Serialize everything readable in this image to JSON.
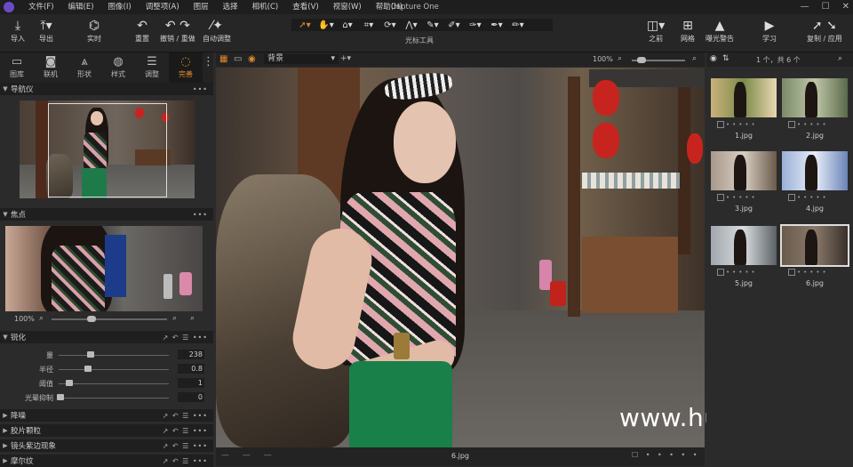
{
  "menubar": {
    "items": [
      "文件(F)",
      "编辑(E)",
      "图像(I)",
      "调整项(A)",
      "图层",
      "选择",
      "相机(C)",
      "查看(V)",
      "视窗(W)",
      "帮助(H)"
    ],
    "title": "Capture One",
    "controls": [
      "—",
      "☐",
      "✕"
    ]
  },
  "toolbar": {
    "import": "导入",
    "export": "导出",
    "live": "实时",
    "reset": "重置",
    "undo_redo": "撤销 / 重做",
    "auto_adjust": "自动调整",
    "cursor_tools": "光标工具",
    "before": "之前",
    "grid": "网格",
    "exposure_warning": "曝光警告",
    "learn": "学习",
    "copy_apply": "复制 / 应用"
  },
  "left_tabs": [
    "图库",
    "联机",
    "形状",
    "样式",
    "调整",
    "完善"
  ],
  "left_tab_active": 5,
  "navigator": {
    "title": "导航仪"
  },
  "focus": {
    "title": "焦点",
    "zoom": "100%"
  },
  "sharpening": {
    "title": "锐化",
    "sliders": [
      {
        "label": "量",
        "value": "238",
        "pos": 0.29
      },
      {
        "label": "半径",
        "value": "0.8",
        "pos": 0.27
      },
      {
        "label": "阈值",
        "value": "1",
        "pos": 0.1
      },
      {
        "label": "光晕抑制",
        "value": "0",
        "pos": 0.02
      }
    ]
  },
  "collapsed_sections": [
    "降噪",
    "胶片颗粒",
    "镜头紫边现象",
    "摩尔纹"
  ],
  "viewer": {
    "variant": "背景",
    "zoom": "100%",
    "filename": "6.jpg"
  },
  "browser": {
    "count": "1 个，共 6 个",
    "thumbs": [
      "1.jpg",
      "2.jpg",
      "3.jpg",
      "4.jpg",
      "5.jpg",
      "6.jpg"
    ],
    "selected": 5
  },
  "watermark": "www.hunls.com",
  "colors": {
    "accent": "#e08a2a"
  }
}
